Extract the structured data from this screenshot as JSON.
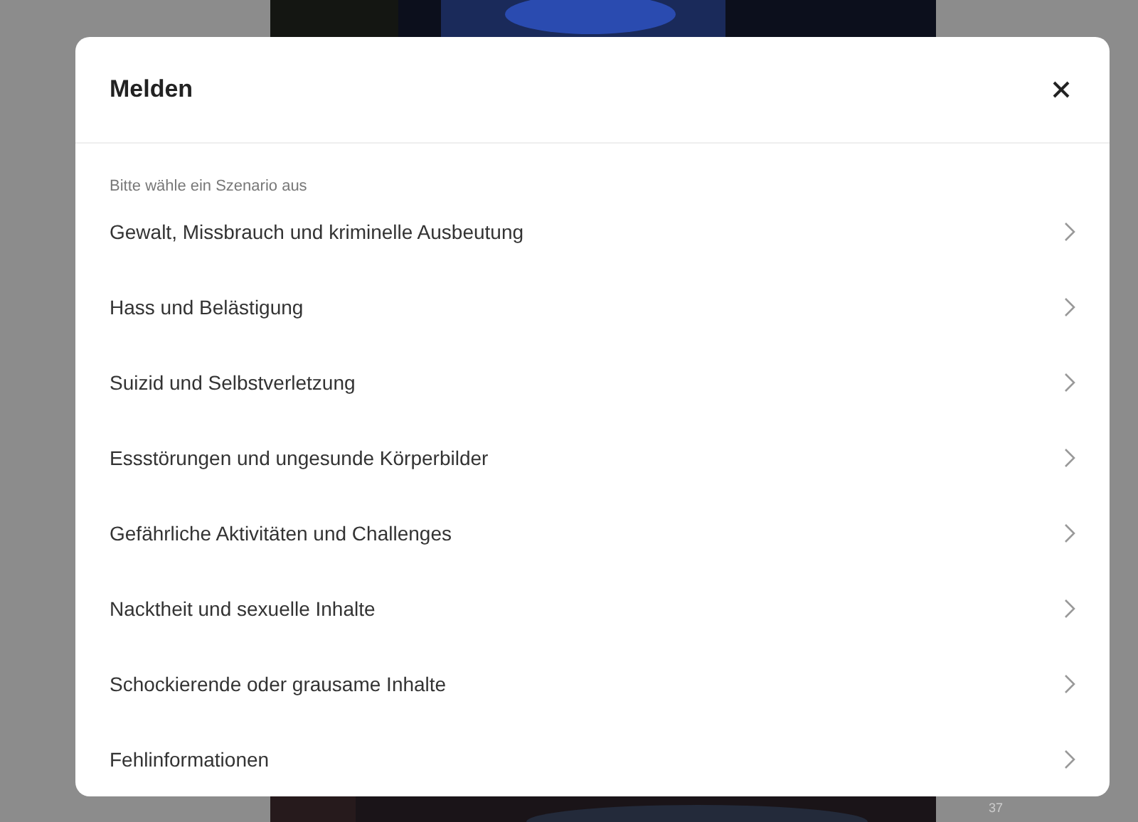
{
  "dialog": {
    "title": "Melden",
    "prompt": "Bitte wähle ein Szenario aus",
    "items": [
      {
        "label": "Gewalt, Missbrauch und kriminelle Ausbeutung"
      },
      {
        "label": "Hass und Belästigung"
      },
      {
        "label": "Suizid und Selbstverletzung"
      },
      {
        "label": "Essstörungen und ungesunde Körperbilder"
      },
      {
        "label": "Gefährliche Aktivitäten und Challenges"
      },
      {
        "label": "Nacktheit und sexuelle Inhalte"
      },
      {
        "label": "Schockierende oder grausame Inhalte"
      },
      {
        "label": "Fehlinformationen"
      }
    ]
  },
  "video": {
    "counter": "37"
  }
}
